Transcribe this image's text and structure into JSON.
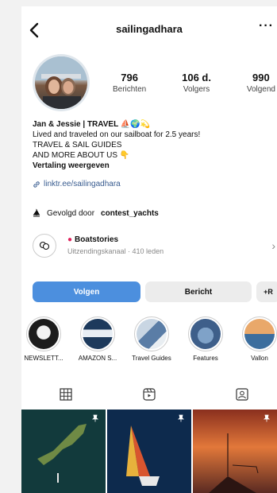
{
  "header": {
    "username": "sailingadhara",
    "more_label": "···"
  },
  "stats": [
    {
      "value": "796",
      "label": "Berichten"
    },
    {
      "value": "106 d.",
      "label": "Volgers"
    },
    {
      "value": "990",
      "label": "Volgend"
    }
  ],
  "bio": {
    "name": "Jan & Jessie | TRAVEL ⛵🌍💫",
    "line1": "Lived and traveled on our sailboat for 2.5 years!",
    "line2": "TRAVEL & SAIL GUIDES",
    "line3": "AND MORE ABOUT US 👇",
    "translate": "Vertaling weergeven",
    "link": "linktr.ee/sailingadhara"
  },
  "followed_by": {
    "prefix": "Gevolgd door",
    "account": "contest_yachts"
  },
  "channel": {
    "title": "Boatstories",
    "subtitle": "Uitzendingskanaal · 410 leden"
  },
  "actions": {
    "follow": "Volgen",
    "message": "Bericht",
    "add_person": "+R"
  },
  "highlights": [
    {
      "label": "NEWSLETT..."
    },
    {
      "label": "AMAZON S..."
    },
    {
      "label": "Travel Guides"
    },
    {
      "label": "Features"
    },
    {
      "label": "Vallon"
    }
  ],
  "colors": {
    "accent": "#4c8fde",
    "link": "#385b8f",
    "live_dot": "#e0245e"
  }
}
